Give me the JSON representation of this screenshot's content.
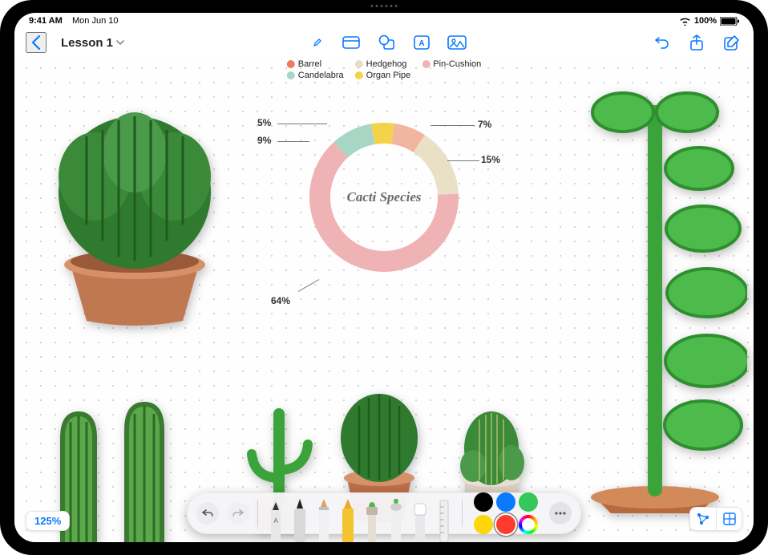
{
  "status": {
    "time": "9:41 AM",
    "date": "Mon Jun 10",
    "battery_pct": "100%"
  },
  "nav": {
    "back_label": "",
    "title": "Lesson 1"
  },
  "zoom_label": "125%",
  "chart_data": {
    "type": "pie",
    "title": "Cacti Species",
    "series": [
      {
        "name": "Barrel",
        "value": 7,
        "label": "7%",
        "color": "#f2b6a0"
      },
      {
        "name": "Hedgehog",
        "value": 15,
        "label": "15%",
        "color": "#e9e0c6"
      },
      {
        "name": "Pin-Cushion",
        "value": 64,
        "label": "64%",
        "color": "#efb3b5"
      },
      {
        "name": "Candelabra",
        "value": 9,
        "label": "9%",
        "color": "#a7d6c4"
      },
      {
        "name": "Organ Pipe",
        "value": 5,
        "label": "5%",
        "color": "#f4d24a"
      }
    ],
    "legend": [
      {
        "name": "Barrel",
        "color": "#ef7a5a"
      },
      {
        "name": "Hedgehog",
        "color": "#e7ddc0"
      },
      {
        "name": "Pin-Cushion",
        "color": "#efb3b5"
      },
      {
        "name": "Candelabra",
        "color": "#a7d6c4"
      },
      {
        "name": "Organ Pipe",
        "color": "#f4d24a"
      }
    ]
  },
  "palette": {
    "colors": [
      "#000000",
      "#0a7aff",
      "#34c759",
      "#ffd60a",
      "#ff3b30"
    ],
    "selected_index": 4
  }
}
